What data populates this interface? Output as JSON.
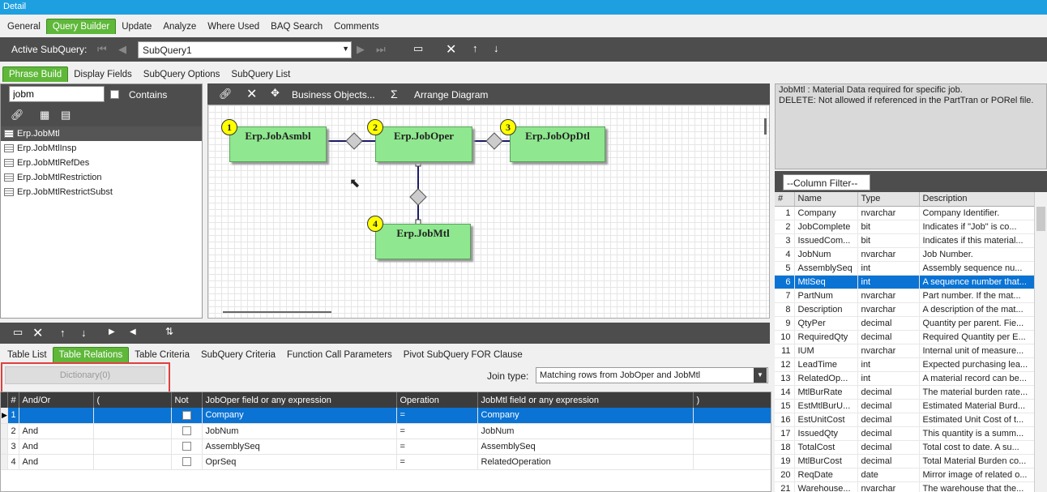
{
  "window": {
    "title": "Detail"
  },
  "main_tabs": [
    "General",
    "Query Builder",
    "Update",
    "Analyze",
    "Where Used",
    "BAQ Search",
    "Comments"
  ],
  "main_tab_active": 1,
  "subquery": {
    "label": "Active SubQuery:",
    "value": "SubQuery1"
  },
  "sub_tabs": [
    "Phrase Build",
    "Display Fields",
    "SubQuery Options",
    "SubQuery List"
  ],
  "sub_tab_active": 0,
  "search": {
    "value": "jobm",
    "contains_label": "Contains"
  },
  "tables": [
    "Erp.JobMtl",
    "Erp.JobMtlInsp",
    "Erp.JobMtlRefDes",
    "Erp.JobMtlRestriction",
    "Erp.JobMtlRestrictSubst"
  ],
  "diagram_toolbar": {
    "business_objects": "Business Objects...",
    "sigma": "Σ",
    "arrange": "Arrange Diagram"
  },
  "diagram_nodes": [
    {
      "num": "1",
      "name": "Erp.JobAsmbl"
    },
    {
      "num": "2",
      "name": "Erp.JobOper"
    },
    {
      "num": "3",
      "name": "Erp.JobOpDtl"
    },
    {
      "num": "4",
      "name": "Erp.JobMtl"
    }
  ],
  "info": {
    "line1": "JobMtl : Material Data required for specific job.",
    "line2": "DELETE: Not allowed if referenced in the PartTran or PORel file."
  },
  "column_filter": "--Column Filter--",
  "columns": {
    "headers": [
      "#",
      "Name",
      "Type",
      "Description"
    ],
    "selected": 5,
    "rows": [
      [
        "1",
        "Company",
        "nvarchar",
        "Company Identifier."
      ],
      [
        "2",
        "JobComplete",
        "bit",
        "Indicates if \"Job\" is co..."
      ],
      [
        "3",
        "IssuedCom...",
        "bit",
        "Indicates if this material..."
      ],
      [
        "4",
        "JobNum",
        "nvarchar",
        "Job Number."
      ],
      [
        "5",
        "AssemblySeq",
        "int",
        "Assembly sequence nu..."
      ],
      [
        "6",
        "MtlSeq",
        "int",
        "A sequence number that..."
      ],
      [
        "7",
        "PartNum",
        "nvarchar",
        "Part number.  If the mat..."
      ],
      [
        "8",
        "Description",
        "nvarchar",
        "A description of the mat..."
      ],
      [
        "9",
        "QtyPer",
        "decimal",
        "Quantity per parent.  Fie..."
      ],
      [
        "10",
        "RequiredQty",
        "decimal",
        "Required Quantity per E..."
      ],
      [
        "11",
        "IUM",
        "nvarchar",
        "Internal unit of measure..."
      ],
      [
        "12",
        "LeadTime",
        "int",
        "Expected purchasing lea..."
      ],
      [
        "13",
        "RelatedOp...",
        "int",
        "A material record can be..."
      ],
      [
        "14",
        "MtlBurRate",
        "decimal",
        "The material burden rate..."
      ],
      [
        "15",
        "EstMtlBurU...",
        "decimal",
        "Estimated Material Burd..."
      ],
      [
        "16",
        "EstUnitCost",
        "decimal",
        "Estimated Unit Cost of t..."
      ],
      [
        "17",
        "IssuedQty",
        "decimal",
        "This quantity is a summ..."
      ],
      [
        "18",
        "TotalCost",
        "decimal",
        "Total cost to date.  A su..."
      ],
      [
        "19",
        "MtlBurCost",
        "decimal",
        "Total Material Burden co..."
      ],
      [
        "20",
        "ReqDate",
        "date",
        "Mirror image of related o..."
      ],
      [
        "21",
        "Warehouse...",
        "nvarchar",
        "The warehouse that the..."
      ]
    ]
  },
  "bottom_tabs": [
    "Table List",
    "Table Relations",
    "Table Criteria",
    "SubQuery Criteria",
    "Function Call Parameters",
    "Pivot SubQuery FOR Clause"
  ],
  "bottom_tab_active": 1,
  "dictionary_label": "Dictionary(0)",
  "join": {
    "label": "Join type:",
    "value": "Matching rows from JobOper and JobMtl"
  },
  "relations": {
    "headers": [
      "#",
      "And/Or",
      "(",
      "Not",
      "JobOper field or any expression",
      "Operation",
      "JobMtl field or any expression",
      ")"
    ],
    "rows": [
      [
        "1",
        "",
        "",
        "",
        "Company",
        "=",
        "Company",
        ""
      ],
      [
        "2",
        "And",
        "",
        "",
        "JobNum",
        "=",
        "JobNum",
        ""
      ],
      [
        "3",
        "And",
        "",
        "",
        "AssemblySeq",
        "=",
        "AssemblySeq",
        ""
      ],
      [
        "4",
        "And",
        "",
        "",
        "OprSeq",
        "=",
        "RelatedOperation",
        ""
      ]
    ]
  },
  "colors": {
    "accent": "#5fb83a",
    "title": "#1ea0e0",
    "select": "#0a73d4",
    "node": "#8fe88f",
    "highlight": "#e04040"
  }
}
